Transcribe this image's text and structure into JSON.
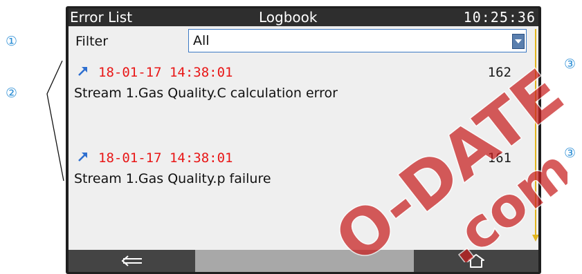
{
  "callouts": {
    "one": "①",
    "two": "②",
    "three_top": "③",
    "three_bottom": "③"
  },
  "titlebar": {
    "left": "Error List",
    "center": "Logbook",
    "time": "10:25:36"
  },
  "filter": {
    "label": "Filter",
    "value": "All"
  },
  "entries": [
    {
      "timestamp": "18-01-17 14:38:01",
      "count": "162",
      "message": "Stream 1.Gas Quality.C calculation error",
      "icon": "arrow-up-right-icon"
    },
    {
      "timestamp": "18-01-17 14:38:01",
      "count": "161",
      "message": "Stream 1.Gas Quality.p failure",
      "icon": "arrow-up-right-icon"
    }
  ],
  "bottombar": {
    "back_icon": "back-arrow-icon",
    "home_icon": "home-icon"
  },
  "watermark": {
    "text1": "O-DATE",
    "text2": ".com"
  },
  "colors": {
    "callout": "#2d8fd6",
    "timestamp": "#e81616",
    "accent_scroll": "#e1b51f",
    "titlebar_bg": "#2e2e2e",
    "watermark": "#c81f1f"
  }
}
